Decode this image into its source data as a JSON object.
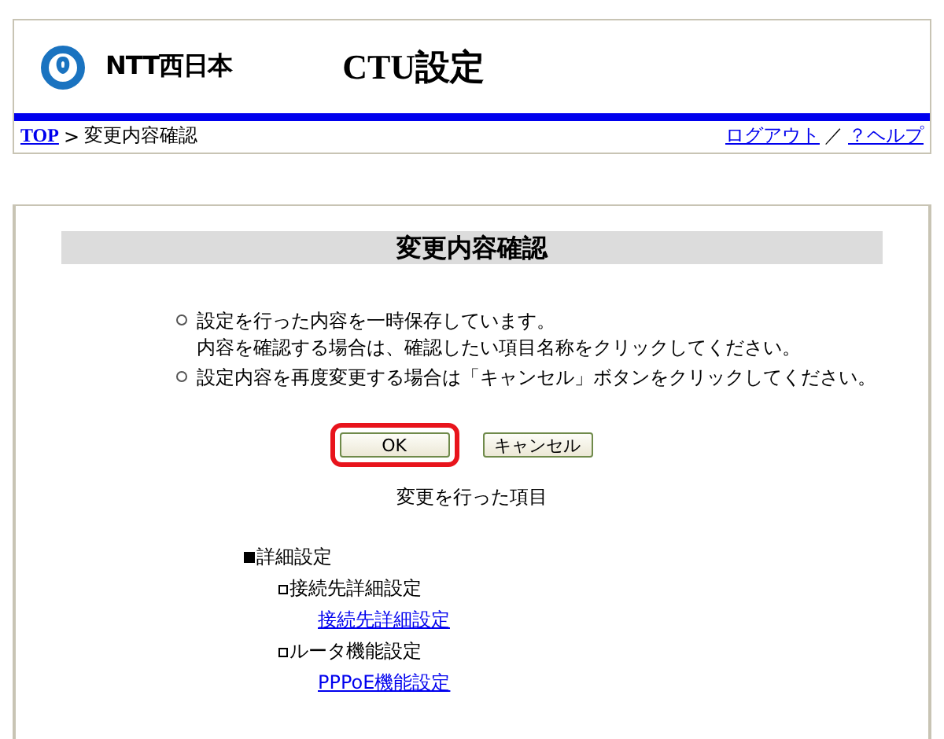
{
  "header": {
    "brand": "NTT西日本",
    "title": "CTU設定"
  },
  "breadcrumb": [
    {
      "kind": "link",
      "label": "TOP"
    },
    {
      "kind": "separator",
      "label": ">"
    },
    {
      "kind": "text",
      "label": "変更内容確認"
    }
  ],
  "top_links": [
    {
      "kind": "link",
      "label": "ログアウト"
    },
    {
      "kind": "separator",
      "label": "／"
    },
    {
      "kind": "link",
      "label": "？ヘルプ"
    }
  ],
  "panel": {
    "title": "変更内容確認",
    "notes": [
      {
        "lines": [
          "設定を行った内容を一時保存しています。",
          "内容を確認する場合は、確認したい項目名称をクリックしてください。"
        ]
      },
      {
        "lines": [
          "設定内容を再度変更する場合は「キャンセル」ボタンをクリックしてください。"
        ]
      }
    ],
    "buttons": [
      {
        "label": "OK",
        "highlighted": true
      },
      {
        "label": "キャンセル",
        "highlighted": false
      }
    ],
    "changes_heading": "変更を行った項目",
    "tree": [
      {
        "label": "詳細設定",
        "kind": "section",
        "children": [
          {
            "label": "接続先詳細設定",
            "kind": "group",
            "children": [
              {
                "label": "接続先詳細設定",
                "kind": "link"
              }
            ]
          },
          {
            "label": "ルータ機能設定",
            "kind": "group",
            "children": [
              {
                "label": "PPPoE機能設定",
                "kind": "link"
              }
            ]
          }
        ]
      }
    ]
  }
}
